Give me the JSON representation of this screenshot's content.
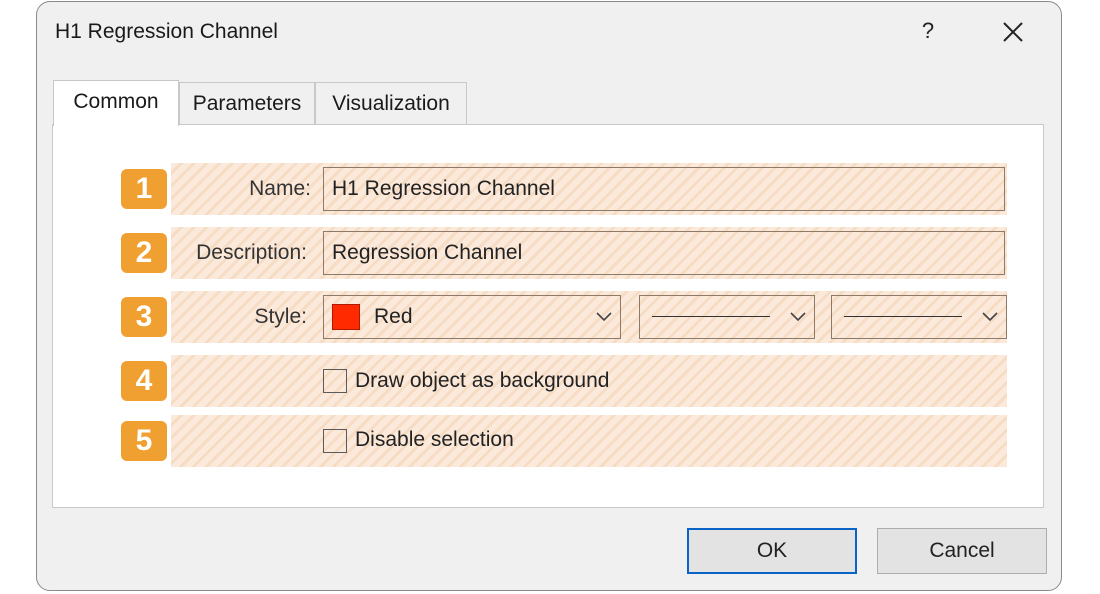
{
  "window": {
    "title": "H1 Regression Channel",
    "help_label": "?"
  },
  "tabs": [
    {
      "label": "Common",
      "active": true
    },
    {
      "label": "Parameters",
      "active": false
    },
    {
      "label": "Visualization",
      "active": false
    }
  ],
  "badges": [
    "1",
    "2",
    "3",
    "4",
    "5"
  ],
  "fields": {
    "name_label": "Name:",
    "name_value": "H1 Regression Channel",
    "description_label": "Description:",
    "description_value": "Regression Channel",
    "style_label": "Style:",
    "color_value": "Red",
    "color_hex": "#ff2a00"
  },
  "checkboxes": {
    "draw_background_label": "Draw object as background",
    "draw_background_checked": false,
    "disable_selection_label": "Disable selection",
    "disable_selection_checked": false
  },
  "buttons": {
    "ok_label": "OK",
    "cancel_label": "Cancel"
  },
  "icons": {
    "close": "close-icon",
    "chevron": "chevron-down-icon"
  },
  "colors": {
    "badge": "#f0a030",
    "highlight": "#fbeadb",
    "default_button_border": "#0a64c8"
  }
}
